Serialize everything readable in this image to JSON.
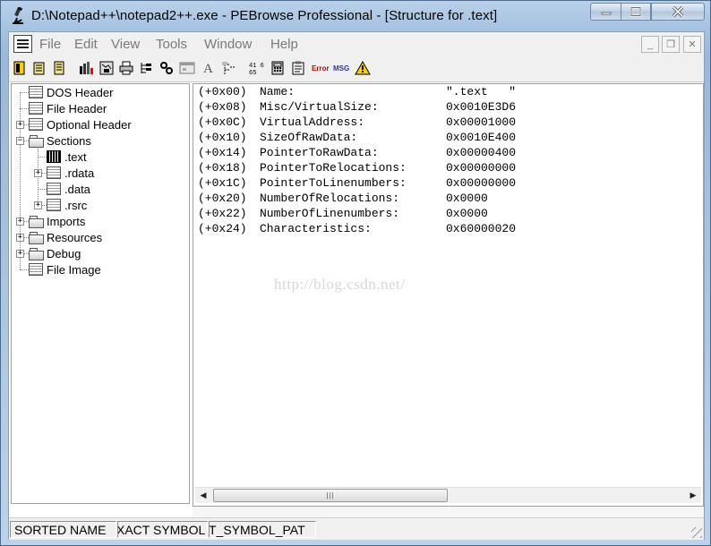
{
  "window": {
    "title": "D:\\Notepad++\\notepad2++.exe - PEBrowse Professional - [Structure for .text]"
  },
  "menubar": {
    "items": [
      "File",
      "Edit",
      "View",
      "Tools",
      "Window",
      "Help"
    ]
  },
  "toolbar": {
    "icons": [
      "open-file-icon",
      "open-exe-icon",
      "open-dll-icon",
      "chart-icon",
      "map-icon",
      "print-icon",
      "tree-icon",
      "gear-tree-icon",
      "dialog-icon",
      "font-icon",
      "hierarchy-icon",
      "hex-icon",
      "calculator-icon",
      "clipboard-icon",
      "error-icon",
      "message-icon",
      "warning-icon"
    ],
    "icon_texts": {
      "hex": "41 65",
      "error": "Error",
      "msg": "MSG"
    }
  },
  "tree": {
    "items": [
      {
        "label": "DOS Header",
        "icon": "grid"
      },
      {
        "label": "File Header",
        "icon": "grid"
      },
      {
        "label": "Optional Header",
        "icon": "grid",
        "expander": "+"
      },
      {
        "label": "Sections",
        "icon": "folder",
        "expander": "−"
      },
      {
        "label": ".text",
        "icon": "grid-selected"
      },
      {
        "label": ".rdata",
        "icon": "grid",
        "expander": "+"
      },
      {
        "label": ".data",
        "icon": "grid"
      },
      {
        "label": ".rsrc",
        "icon": "grid",
        "expander": "+"
      },
      {
        "label": "Imports",
        "icon": "folder",
        "expander": "+"
      },
      {
        "label": "Resources",
        "icon": "folder",
        "expander": "+"
      },
      {
        "label": "Debug",
        "icon": "folder",
        "expander": "+"
      },
      {
        "label": "File Image",
        "icon": "grid"
      }
    ]
  },
  "detail": {
    "rows": [
      {
        "offset": "(+0x00)",
        "field": "Name:",
        "value": "\".text   \""
      },
      {
        "offset": "(+0x08)",
        "field": "Misc/VirtualSize:",
        "value": "0x0010E3D6"
      },
      {
        "offset": "(+0x0C)",
        "field": "VirtualAddress:",
        "value": "0x00001000"
      },
      {
        "offset": "(+0x10)",
        "field": "SizeOfRawData:",
        "value": "0x0010E400"
      },
      {
        "offset": "(+0x14)",
        "field": "PointerToRawData:",
        "value": "0x00000400"
      },
      {
        "offset": "(+0x18)",
        "field": "PointerToRelocations:",
        "value": "0x00000000"
      },
      {
        "offset": "(+0x1C)",
        "field": "PointerToLinenumbers:",
        "value": "0x00000000"
      },
      {
        "offset": "(+0x20)",
        "field": "NumberOfRelocations:",
        "value": "0x0000"
      },
      {
        "offset": "(+0x22)",
        "field": "NumberOfLinenumbers:",
        "value": "0x0000"
      },
      {
        "offset": "(+0x24)",
        "field": "Characteristics:",
        "value": "0x60000020"
      }
    ],
    "watermark": "http://blog.csdn.net/"
  },
  "statusbar": {
    "panels": [
      "SORTED NAME",
      "XACT SYMBOL",
      "T_SYMBOL_PAT"
    ]
  }
}
